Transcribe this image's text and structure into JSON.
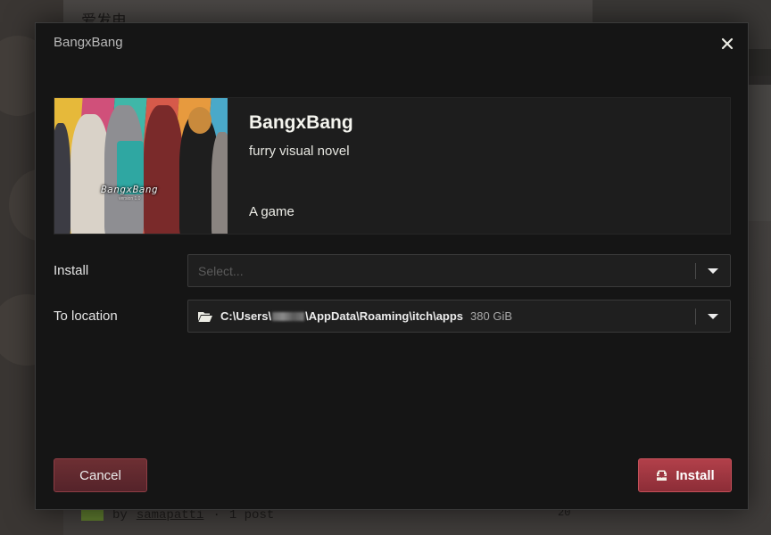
{
  "background": {
    "top_text": "爱发电",
    "footer": {
      "by": "by",
      "user": "samapatti",
      "sep": "·",
      "posts": "1 post",
      "count": "20"
    }
  },
  "modal": {
    "title": "BangxBang",
    "close_icon": "close-icon",
    "game": {
      "title": "BangxBang",
      "subtitle": "furry visual novel",
      "type": "A game",
      "cover_logo": "BangxBang",
      "cover_version": "version 1.0"
    },
    "install": {
      "label": "Install",
      "placeholder": "Select..."
    },
    "location": {
      "label": "To location",
      "path_prefix": "C:\\Users\\",
      "path_suffix": "\\AppData\\Roaming\\itch\\apps",
      "free_space": "380 GiB",
      "icon": "folder-open-icon"
    },
    "buttons": {
      "cancel": "Cancel",
      "install": "Install",
      "install_icon": "download-tray-icon"
    }
  },
  "colors": {
    "accent": "#b2404a",
    "modal_bg": "#151515",
    "card_bg": "#1d1d1d"
  }
}
